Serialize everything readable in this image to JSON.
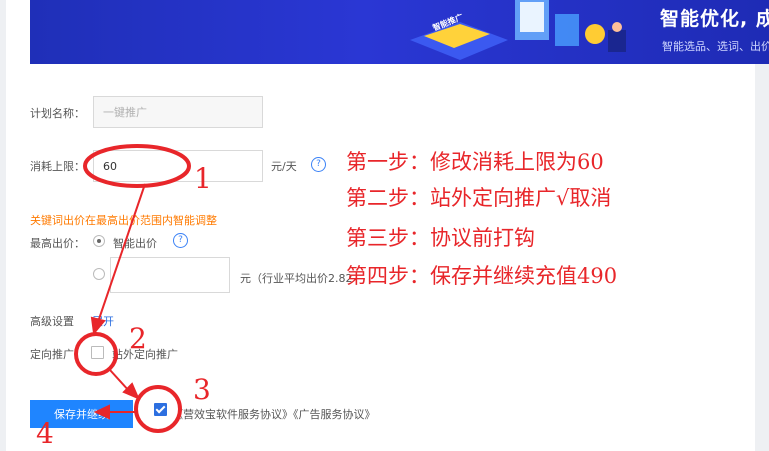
{
  "banner": {
    "title": "智能优化, 成",
    "subtitle": "智能选品、选词、出价",
    "tag": "智能推广"
  },
  "form": {
    "plan_name_label": "计划名称：",
    "plan_name_placeholder": "一键推广",
    "budget_label": "消耗上限：",
    "budget_value": "60",
    "budget_unit": "元/天",
    "keyword_notice": "关键词出价在最高出价范围内智能调整",
    "max_bid_label": "最高出价：",
    "smart_bid_label": "智能出价",
    "custom_bid_unit": "元（行业平均出价2.82",
    "advanced_label": "高级设置",
    "expand_link": "展开",
    "targeting_label": "定向推广：",
    "offsite_label": "站外定向推广",
    "agreement_text": "《营效宝软件服务协议》《广告服务协议》",
    "save_button": "保存并继续"
  },
  "annotations": {
    "steps": [
      "第一步：修改消耗上限为60",
      "第二步：站外定向推广√取消",
      "第三步：协议前打钩",
      "第四步：保存并继续充值490"
    ],
    "numbers": [
      "1",
      "2",
      "3",
      "4"
    ]
  },
  "colors": {
    "banner": "#2a37d4",
    "accent": "#1f85ff",
    "annotation": "#e8262a",
    "notice": "#ff7a00"
  }
}
